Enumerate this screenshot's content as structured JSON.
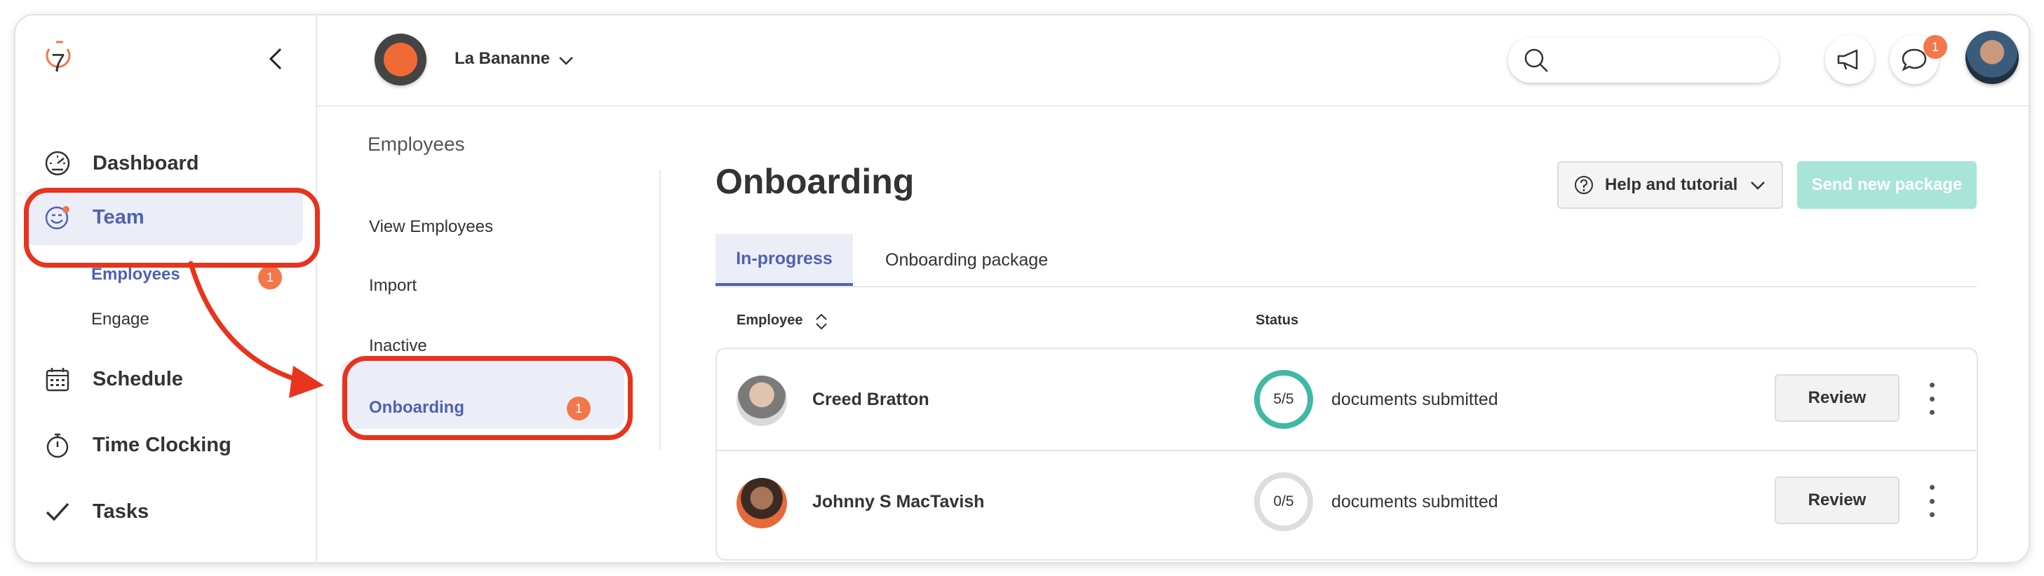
{
  "sidebar": {
    "logo_text": "7",
    "items": [
      {
        "label": "Dashboard",
        "icon": "speedometer-icon"
      },
      {
        "label": "Team",
        "icon": "team-face-icon"
      },
      {
        "label": "Schedule",
        "icon": "calendar-icon"
      },
      {
        "label": "Time Clocking",
        "icon": "stopwatch-icon"
      },
      {
        "label": "Tasks",
        "icon": "checkmark-icon"
      }
    ],
    "team_sub": {
      "employees_label": "Employees",
      "employees_badge": "1",
      "engage_label": "Engage"
    }
  },
  "topbar": {
    "org_name": "La Bananne",
    "search": {
      "placeholder": ""
    },
    "notifications_badge": "1"
  },
  "subnav": {
    "title": "Employees",
    "items": [
      "View Employees",
      "Import",
      "Inactive",
      "Onboarding"
    ],
    "onboarding_badge": "1"
  },
  "main": {
    "title": "Onboarding",
    "help_label": "Help and tutorial",
    "send_label": "Send new package",
    "tabs": [
      "In-progress",
      "Onboarding package"
    ],
    "columns": {
      "employee": "Employee",
      "status": "Status"
    },
    "rows": [
      {
        "name": "Creed Bratton",
        "progress": "5/5",
        "completed": 5,
        "total": 5,
        "status_text": "documents submitted",
        "action": "Review"
      },
      {
        "name": "Johnny S MacTavish",
        "progress": "0/5",
        "completed": 0,
        "total": 5,
        "status_text": "documents submitted",
        "action": "Review"
      }
    ]
  },
  "colors": {
    "accent": "#4f62b5",
    "badge": "#f2774b",
    "success_ring": "#3fb9a5",
    "empty_ring": "#dddddd",
    "send_button": "#a8e4d8",
    "annotation": "#e8331e"
  }
}
